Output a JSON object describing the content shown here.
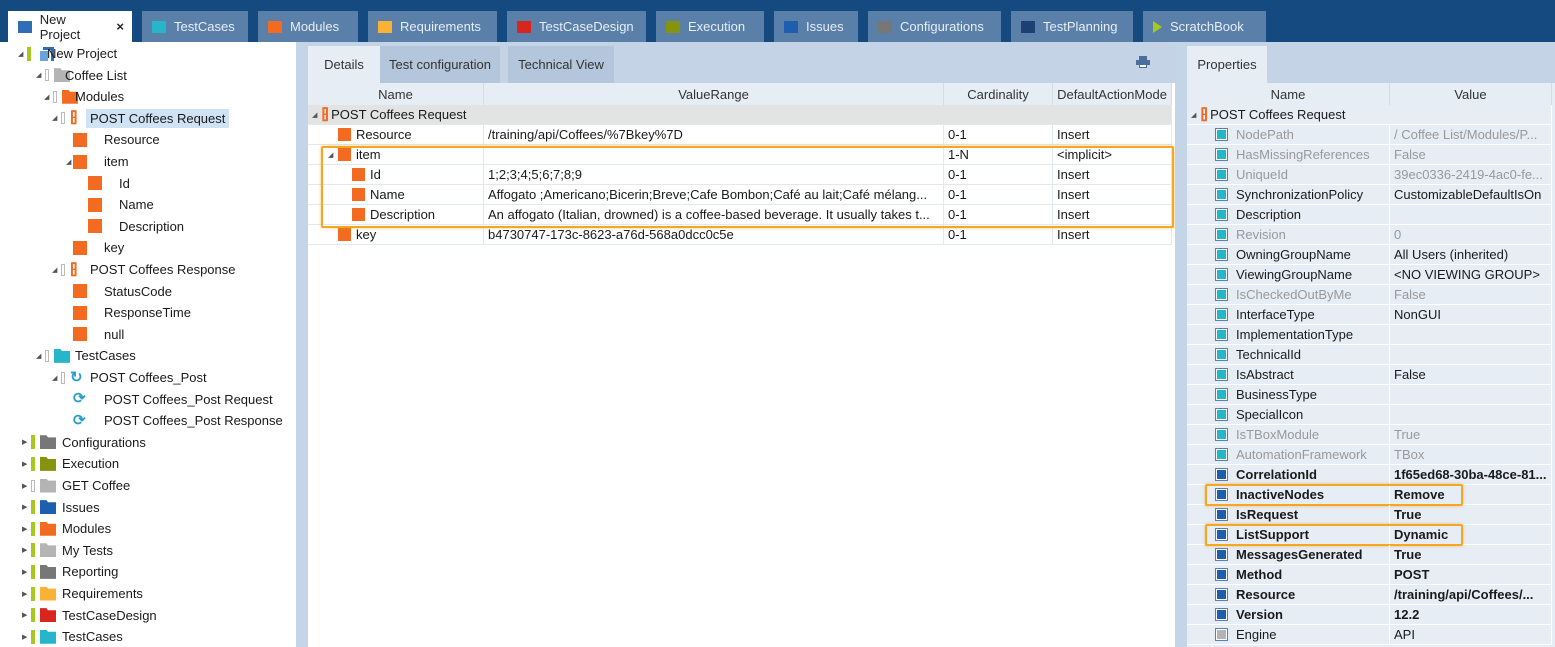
{
  "colors": {
    "titlebar": "#154a80",
    "accent_highlight": "#f5a623",
    "module_orange": "#f26b21"
  },
  "top_tabs": [
    {
      "label": "New Project",
      "icon": "project-icon",
      "color": "#2f6db5",
      "active": true,
      "close": "×"
    },
    {
      "label": "TestCases",
      "icon": "folder-icon",
      "color": "#27b6c9"
    },
    {
      "label": "Modules",
      "icon": "folder-icon",
      "color": "#f26b21"
    },
    {
      "label": "Requirements",
      "icon": "folder-icon",
      "color": "#f9b233"
    },
    {
      "label": "TestCaseDesign",
      "icon": "folder-icon",
      "color": "#d7261e"
    },
    {
      "label": "Execution",
      "icon": "folder-icon",
      "color": "#85940f"
    },
    {
      "label": "Issues",
      "icon": "folder-icon",
      "color": "#1d5fae"
    },
    {
      "label": "Configurations",
      "icon": "configurations-icon",
      "color": "#777777"
    },
    {
      "label": "TestPlanning",
      "icon": "testplanning-icon",
      "color": "#1d3f72"
    },
    {
      "label": "ScratchBook",
      "icon": "play-icon",
      "color": "#a6c81f"
    }
  ],
  "tree": [
    {
      "label": "New Project",
      "level": 0,
      "expanded": true,
      "icon": "project",
      "color": "#2f6db5",
      "mark": "bar"
    },
    {
      "label": "Coffee List",
      "level": 1,
      "expanded": true,
      "icon": "folder",
      "color": "#b4b4b4",
      "mark": "hollow"
    },
    {
      "label": "Modules",
      "level": 2,
      "expanded": true,
      "icon": "folder",
      "color": "#f26b21",
      "mark": "hollow"
    },
    {
      "label": "POST Coffees Request",
      "level": 3,
      "expanded": true,
      "icon": "module",
      "color": "#f26b21",
      "mark": "hollow",
      "selected": true
    },
    {
      "label": "Resource",
      "level": 4,
      "icon": "attr",
      "color": "#f26b21"
    },
    {
      "label": "item",
      "level": 4,
      "expanded": true,
      "icon": "attr",
      "color": "#f26b21"
    },
    {
      "label": "Id",
      "level": 5,
      "icon": "attr",
      "color": "#f26b21"
    },
    {
      "label": "Name",
      "level": 5,
      "icon": "attr",
      "color": "#f26b21"
    },
    {
      "label": "Description",
      "level": 5,
      "icon": "attr",
      "color": "#f26b21"
    },
    {
      "label": "key",
      "level": 4,
      "icon": "attr",
      "color": "#f26b21"
    },
    {
      "label": "POST Coffees Response",
      "level": 3,
      "expanded": true,
      "icon": "module",
      "color": "#f26b21",
      "mark": "hollow"
    },
    {
      "label": "StatusCode",
      "level": 4,
      "icon": "attr",
      "color": "#f26b21"
    },
    {
      "label": "ResponseTime",
      "level": 4,
      "icon": "attr",
      "color": "#f26b21"
    },
    {
      "label": "null",
      "level": 4,
      "icon": "attr",
      "color": "#f26b21"
    },
    {
      "label": "TestCases",
      "level": 2,
      "expanded": true,
      "icon": "folder",
      "color": "#27b6c9",
      "mark": "hollow",
      "alt": true
    },
    {
      "label": "POST Coffees_Post",
      "level": 3,
      "expanded": true,
      "icon": "testcase",
      "color": "#27a0c9",
      "mark": "hollow"
    },
    {
      "label": "POST Coffees_Post Request",
      "level": 4,
      "icon": "teststep",
      "color": "#27a0c9"
    },
    {
      "label": "POST Coffees_Post Response",
      "level": 4,
      "icon": "teststep",
      "color": "#27a0c9"
    },
    {
      "label": "Configurations",
      "level": 1,
      "collapsed": true,
      "icon": "folder",
      "color": "#777777",
      "mark": "bar",
      "top": true
    },
    {
      "label": "Execution",
      "level": 1,
      "collapsed": true,
      "icon": "folder",
      "color": "#85940f",
      "mark": "bar",
      "top": true
    },
    {
      "label": "GET Coffee",
      "level": 1,
      "collapsed": true,
      "icon": "folder",
      "color": "#b4b4b4",
      "mark": "hollow",
      "top": true
    },
    {
      "label": "Issues",
      "level": 1,
      "collapsed": true,
      "icon": "folder",
      "color": "#1d5fae",
      "mark": "bar",
      "top": true
    },
    {
      "label": "Modules",
      "level": 1,
      "collapsed": true,
      "icon": "folder",
      "color": "#f26b21",
      "mark": "bar",
      "top": true
    },
    {
      "label": "My Tests",
      "level": 1,
      "collapsed": true,
      "icon": "folder",
      "color": "#b4b4b4",
      "mark": "bar",
      "top": true
    },
    {
      "label": "Reporting",
      "level": 1,
      "collapsed": true,
      "icon": "folder",
      "color": "#777777",
      "mark": "bar",
      "top": true
    },
    {
      "label": "Requirements",
      "level": 1,
      "collapsed": true,
      "icon": "folder",
      "color": "#f9b233",
      "mark": "bar",
      "top": true
    },
    {
      "label": "TestCaseDesign",
      "level": 1,
      "collapsed": true,
      "icon": "folder",
      "color": "#d7261e",
      "mark": "bar",
      "top": true
    },
    {
      "label": "TestCases",
      "level": 1,
      "collapsed": true,
      "icon": "folder",
      "color": "#27b6c9",
      "mark": "bar",
      "top": true
    }
  ],
  "details": {
    "tabs": [
      "Details",
      "Test configuration",
      "Technical View"
    ],
    "print_icon": "print-icon",
    "columns": [
      "Name",
      "ValueRange",
      "Cardinality",
      "DefaultActionMode"
    ],
    "root": "POST Coffees Request",
    "rows": [
      {
        "name": "Resource",
        "level": 1,
        "value": "/training/api/Coffees/%7Bkey%7D",
        "card": "0-1",
        "mode": "Insert"
      },
      {
        "name": "item",
        "level": 1,
        "expanded": true,
        "value": "",
        "card": "1-N",
        "mode": "<implicit>"
      },
      {
        "name": "Id",
        "level": 2,
        "value": "1;2;3;4;5;6;7;8;9",
        "card": "0-1",
        "mode": "Insert"
      },
      {
        "name": "Name",
        "level": 2,
        "value": "Affogato ;Americano;Bicerin;Breve;Cafe Bombon;Café au lait;Café mélang...",
        "card": "0-1",
        "mode": "Insert"
      },
      {
        "name": "Description",
        "level": 2,
        "value": "An affogato (Italian, drowned) is a coffee-based beverage. It usually takes t...",
        "card": "0-1",
        "mode": "Insert"
      },
      {
        "name": "key",
        "level": 1,
        "value": "b4730747-173c-8623-a76d-568a0dcc0c5e",
        "card": "0-1",
        "mode": "Insert"
      }
    ]
  },
  "properties": {
    "tab": "Properties",
    "columns": [
      "Name",
      "Value"
    ],
    "root": "POST Coffees Request",
    "rows": [
      {
        "name": "NodePath",
        "value": "/ Coffee List/Modules/P...",
        "style": "dis",
        "icon": "#27b6c9"
      },
      {
        "name": "HasMissingReferences",
        "value": "False",
        "style": "dis",
        "icon": "#27b6c9"
      },
      {
        "name": "UniqueId",
        "value": "39ec0336-2419-4ac0-fe...",
        "style": "dis",
        "icon": "#27b6c9"
      },
      {
        "name": "SynchronizationPolicy",
        "value": "CustomizableDefaultIsOn",
        "style": "",
        "icon": "#27b6c9"
      },
      {
        "name": "Description",
        "value": "",
        "style": "",
        "icon": "#27b6c9"
      },
      {
        "name": "Revision",
        "value": "0",
        "style": "dis",
        "icon": "#27b6c9"
      },
      {
        "name": "OwningGroupName",
        "value": "All Users (inherited)",
        "style": "",
        "icon": "#27b6c9"
      },
      {
        "name": "ViewingGroupName",
        "value": "<NO VIEWING GROUP>",
        "style": "",
        "icon": "#27b6c9"
      },
      {
        "name": "IsCheckedOutByMe",
        "value": "False",
        "style": "dis",
        "icon": "#27b6c9"
      },
      {
        "name": "InterfaceType",
        "value": "NonGUI",
        "style": "",
        "icon": "#27b6c9"
      },
      {
        "name": "ImplementationType",
        "value": "",
        "style": "",
        "icon": "#27b6c9"
      },
      {
        "name": "TechnicalId",
        "value": "",
        "style": "",
        "icon": "#27b6c9"
      },
      {
        "name": "IsAbstract",
        "value": "False",
        "style": "",
        "icon": "#27b6c9"
      },
      {
        "name": "BusinessType",
        "value": "",
        "style": "",
        "icon": "#27b6c9"
      },
      {
        "name": "SpecialIcon",
        "value": "",
        "style": "",
        "icon": "#27b6c9"
      },
      {
        "name": "IsTBoxModule",
        "value": "True",
        "style": "dis",
        "icon": "#27b6c9"
      },
      {
        "name": "AutomationFramework",
        "value": "TBox",
        "style": "dis",
        "icon": "#27b6c9"
      },
      {
        "name": "CorrelationId",
        "value": "1f65ed68-30ba-48ce-81...",
        "style": "bold",
        "icon": "#1d5fae"
      },
      {
        "name": "InactiveNodes",
        "value": "Remove",
        "style": "bold",
        "icon": "#1d5fae",
        "highlight": true
      },
      {
        "name": "IsRequest",
        "value": "True",
        "style": "bold",
        "icon": "#1d5fae"
      },
      {
        "name": "ListSupport",
        "value": "Dynamic",
        "style": "bold",
        "icon": "#1d5fae",
        "highlight": true
      },
      {
        "name": "MessagesGenerated",
        "value": "True",
        "style": "bold",
        "icon": "#1d5fae"
      },
      {
        "name": "Method",
        "value": "POST",
        "style": "bold",
        "icon": "#1d5fae"
      },
      {
        "name": "Resource",
        "value": "/training/api/Coffees/...",
        "style": "bold",
        "icon": "#1d5fae"
      },
      {
        "name": "Version",
        "value": "12.2",
        "style": "bold",
        "icon": "#1d5fae"
      },
      {
        "name": "Engine",
        "value": "API",
        "style": "",
        "icon": "#b4b4b4"
      }
    ]
  }
}
